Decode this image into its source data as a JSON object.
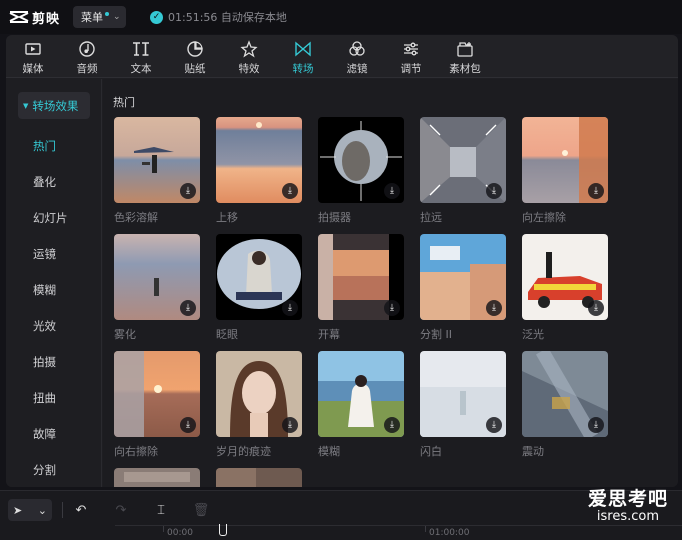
{
  "app": {
    "name": "剪映",
    "menu_label": "菜单",
    "save_status": "01:51:56 自动保存本地"
  },
  "toolbar": [
    {
      "label": "媒体",
      "icon": "media-icon"
    },
    {
      "label": "音频",
      "icon": "audio-icon"
    },
    {
      "label": "文本",
      "icon": "text-icon"
    },
    {
      "label": "贴纸",
      "icon": "sticker-icon"
    },
    {
      "label": "特效",
      "icon": "effects-icon"
    },
    {
      "label": "转场",
      "icon": "transition-icon",
      "active": true
    },
    {
      "label": "滤镜",
      "icon": "filter-icon"
    },
    {
      "label": "调节",
      "icon": "adjust-icon"
    },
    {
      "label": "素材包",
      "icon": "material-pack-icon"
    }
  ],
  "sidebar": {
    "header": "转场效果",
    "items": [
      "热门",
      "叠化",
      "幻灯片",
      "运镜",
      "模糊",
      "光效",
      "拍摄",
      "扭曲",
      "故障",
      "分割"
    ],
    "active_index": 0
  },
  "section": {
    "title": "热门"
  },
  "effects": [
    {
      "label": "色彩溶解"
    },
    {
      "label": "上移"
    },
    {
      "label": "拍摄器"
    },
    {
      "label": "拉远"
    },
    {
      "label": "向左擦除"
    },
    {
      "label": "雾化"
    },
    {
      "label": "眨眼"
    },
    {
      "label": "开幕"
    },
    {
      "label": "分割 II"
    },
    {
      "label": "泛光"
    },
    {
      "label": "向右擦除"
    },
    {
      "label": "岁月的痕迹"
    },
    {
      "label": "模糊"
    },
    {
      "label": "闪白"
    },
    {
      "label": "震动"
    }
  ],
  "timeline": {
    "ticks": [
      "00:00",
      "01:00:00"
    ]
  },
  "watermark": {
    "line1": "爱思考吧",
    "line2": "isres.com"
  },
  "colors": {
    "accent": "#35c9d4",
    "background": "#1e1e22"
  }
}
